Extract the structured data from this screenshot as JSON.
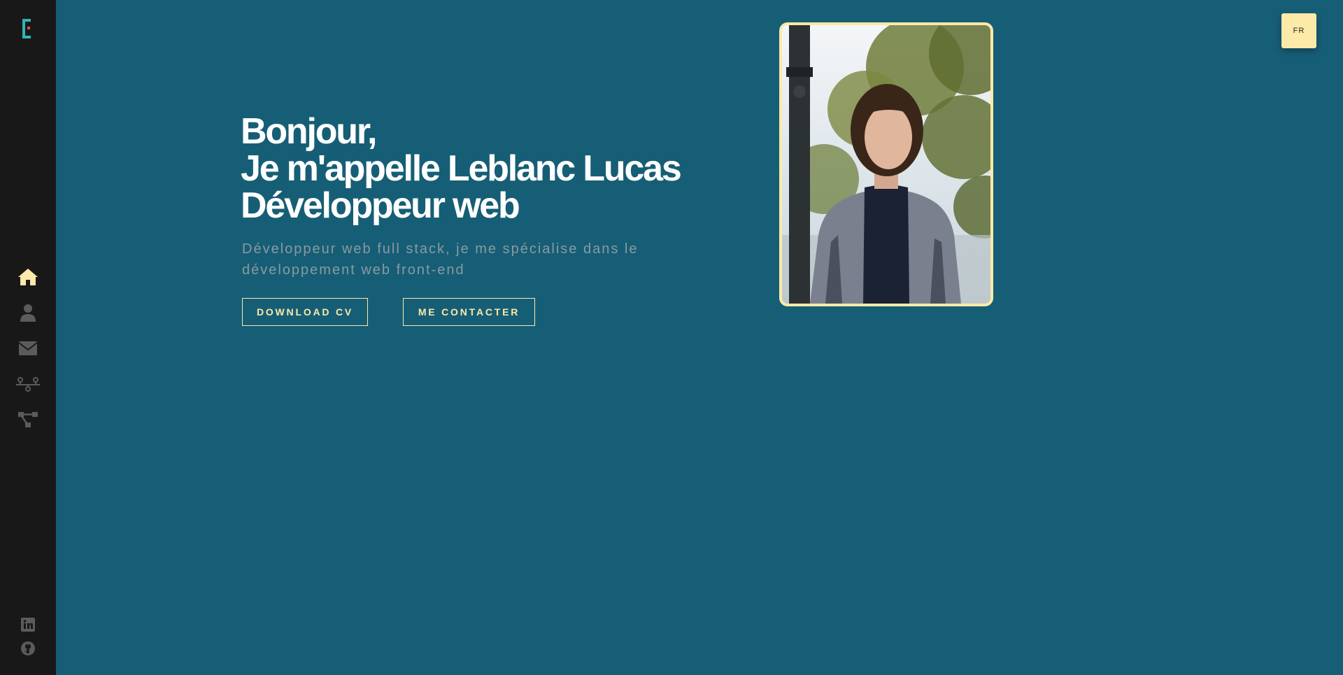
{
  "colors": {
    "background": "#165e76",
    "sidebar": "#181818",
    "accent": "#fde9a8",
    "logo": "#2fb5b3",
    "logo_dot": "#e24b4b",
    "icon_muted": "#5b5b5b",
    "subtitle": "#8a9aa0"
  },
  "sidebar": {
    "logo_icon": "brand-logo-icon",
    "nav_items": [
      {
        "icon": "home-icon",
        "active": true
      },
      {
        "icon": "user-icon",
        "active": false
      },
      {
        "icon": "envelope-icon",
        "active": false
      },
      {
        "icon": "network-icon",
        "active": false
      },
      {
        "icon": "project-diagram-icon",
        "active": false
      }
    ],
    "social": [
      {
        "icon": "linkedin-icon"
      },
      {
        "icon": "github-icon"
      }
    ]
  },
  "hero": {
    "greeting": "Bonjour,",
    "name_line": "Je m'appelle Leblanc Lucas",
    "role_line": "Développeur web",
    "subtitle": "Développeur web full stack, je me spécialise dans le développement web front-end",
    "download_button": "DOWNLOAD CV",
    "contact_button": "ME CONTACTER"
  },
  "profile_photo": {
    "icon": "profile-photo"
  },
  "language_button": "FR"
}
